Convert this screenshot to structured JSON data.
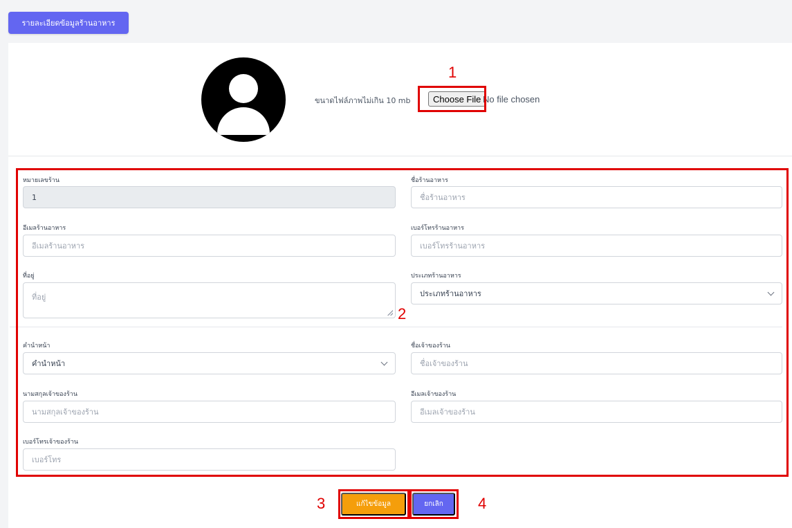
{
  "header": {
    "title": "รายละเอียดข้อมูลร้านอาหาร"
  },
  "upload": {
    "size_label": "ขนาดไฟล์ภาพไม่เกิน 10 mb",
    "choose_file": "Choose File",
    "file_status": "No file chosen"
  },
  "annotations": [
    "1",
    "2",
    "3",
    "4"
  ],
  "form": {
    "shop_id": {
      "label": "หมายเลขร้าน",
      "value": "1"
    },
    "shop_name": {
      "label": "ชื่อร้านอาหาร",
      "placeholder": "ชื่อร้านอาหาร"
    },
    "shop_email": {
      "label": "อีเมลร้านอาหาร",
      "placeholder": "อีเมลร้านอาหาร"
    },
    "shop_phone": {
      "label": "เบอร์โทรร้านอาหาร",
      "placeholder": "เบอร์โทรร้านอาหาร"
    },
    "address": {
      "label": "ที่อยู่",
      "placeholder": "ที่อยู่"
    },
    "shop_type": {
      "label": "ประเภทร้านอาหาร",
      "selected": "ประเภทร้านอาหาร"
    },
    "prefix": {
      "label": "คำนำหน้า",
      "selected": "คำนำหน้า"
    },
    "owner_name": {
      "label": "ชื่อเจ้าของร้าน",
      "placeholder": "ชื่อเจ้าของร้าน"
    },
    "owner_surname": {
      "label": "นามสกุลเจ้าของร้าน",
      "placeholder": "นามสกุลเจ้าของร้าน"
    },
    "owner_email": {
      "label": "อีเมลเจ้าของร้าน",
      "placeholder": "อีเมลเจ้าของร้าน"
    },
    "owner_phone": {
      "label": "เบอร์โทรเจ้าของร้าน",
      "placeholder": "เบอร์โทร"
    }
  },
  "actions": {
    "edit": "แก้ไขข้อมูล",
    "cancel": "ยกเลิก"
  },
  "colors": {
    "primary": "#6366f1",
    "warning": "#f59e0b",
    "annotation": "#e00000"
  }
}
